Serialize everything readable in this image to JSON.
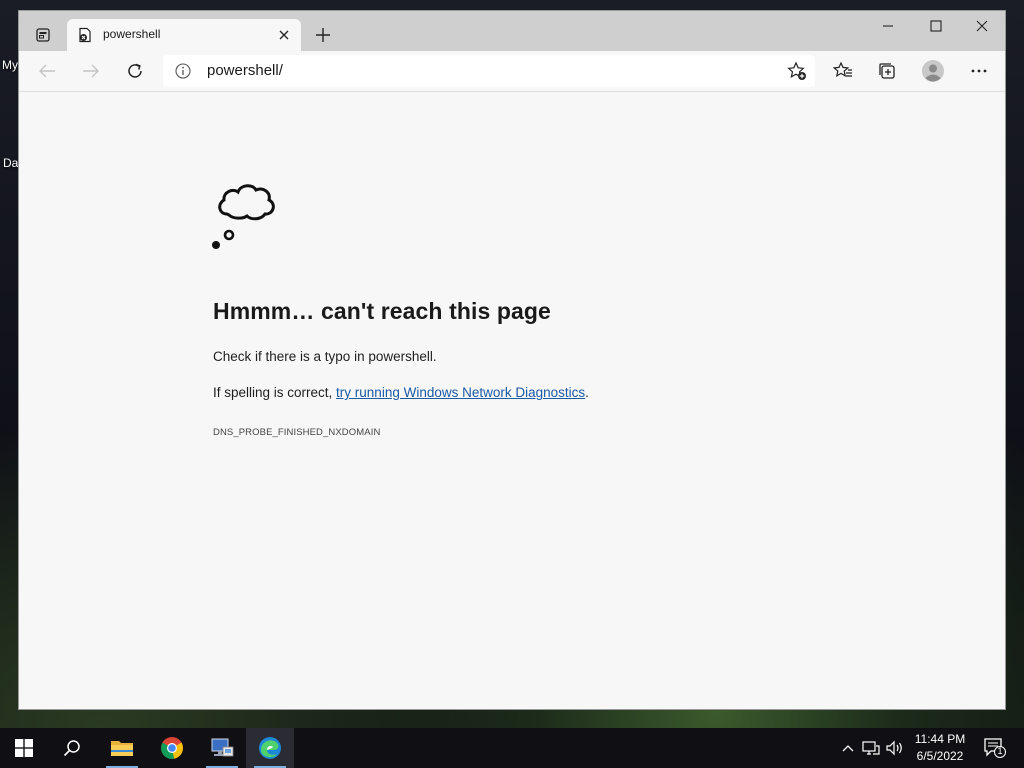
{
  "desktop": {
    "labels": [
      "My",
      "Da"
    ]
  },
  "browser": {
    "tab": {
      "title": "powershell",
      "favicon": "page-error-icon"
    },
    "address": {
      "url": "powershell/"
    },
    "error": {
      "heading": "Hmmm… can't reach this page",
      "line1": "Check if there is a typo in powershell.",
      "line2_prefix": "If spelling is correct, ",
      "line2_link": "try running Windows Network Diagnostics",
      "line2_suffix": ".",
      "code": "DNS_PROBE_FINISHED_NXDOMAIN"
    }
  },
  "taskbar": {
    "apps": [
      "start-icon",
      "search-icon",
      "file-explorer-icon",
      "chrome-icon",
      "network-app-icon",
      "edge-icon"
    ],
    "clock": {
      "time": "11:44 PM",
      "date": "6/5/2022"
    },
    "notification_count": "1"
  },
  "colors": {
    "link": "#1a5aa6",
    "titlebar": "#cfcfcf",
    "page_bg": "#f7f7f7",
    "taskbar": "#101014"
  }
}
